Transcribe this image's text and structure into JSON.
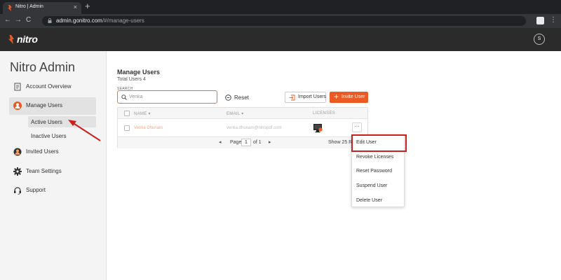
{
  "browser": {
    "tab_title": "Nitro | Admin",
    "tab_close": "×",
    "new_tab": "+",
    "url_host": "admin.gonitro.com",
    "url_path": "/#/manage-users",
    "back": "←",
    "forward": "→",
    "reload": "C",
    "menu": "⋮"
  },
  "header": {
    "logo_text": "nitro",
    "avatar_initial": "S",
    "brand_color": "#ea5a22"
  },
  "sidebar": {
    "title": "Nitro Admin",
    "items": [
      {
        "label": "Account Overview",
        "icon": "document-icon"
      },
      {
        "label": "Manage Users",
        "icon": "user-avatar-icon"
      },
      {
        "label": "Invited Users",
        "icon": "user-icon"
      },
      {
        "label": "Team Settings",
        "icon": "gear-icon"
      },
      {
        "label": "Support",
        "icon": "headset-icon"
      }
    ],
    "sub_items": [
      {
        "label": "Active Users"
      },
      {
        "label": "Inactive Users"
      }
    ]
  },
  "main": {
    "title": "Manage Users",
    "total_users": "Total Users 4",
    "search": {
      "label": "SEARCH",
      "value": "Venka"
    },
    "reset_label": "Reset",
    "import_label": "Import Users",
    "invite_label": "Invite User",
    "table": {
      "headers": {
        "name": "NAME",
        "email": "EMAIL",
        "licenses": "LICENSES"
      },
      "rows": [
        {
          "name": "Venka Dhunam",
          "email": "venka.dhunam@nitropdf.com",
          "more": "···"
        }
      ],
      "footer": {
        "prev": "◂",
        "page_label": "Page",
        "page_value": "1",
        "of_label": "of 1",
        "next": "▸",
        "show_rows": "Show 25 Ro"
      }
    }
  },
  "menu": {
    "items": [
      {
        "label": "Edit User"
      },
      {
        "label": "Revoke Licenses"
      },
      {
        "label": "Reset Password"
      },
      {
        "label": "Suspend User"
      },
      {
        "label": "Delete User"
      }
    ]
  },
  "annotation_color": "#cc1f1f"
}
